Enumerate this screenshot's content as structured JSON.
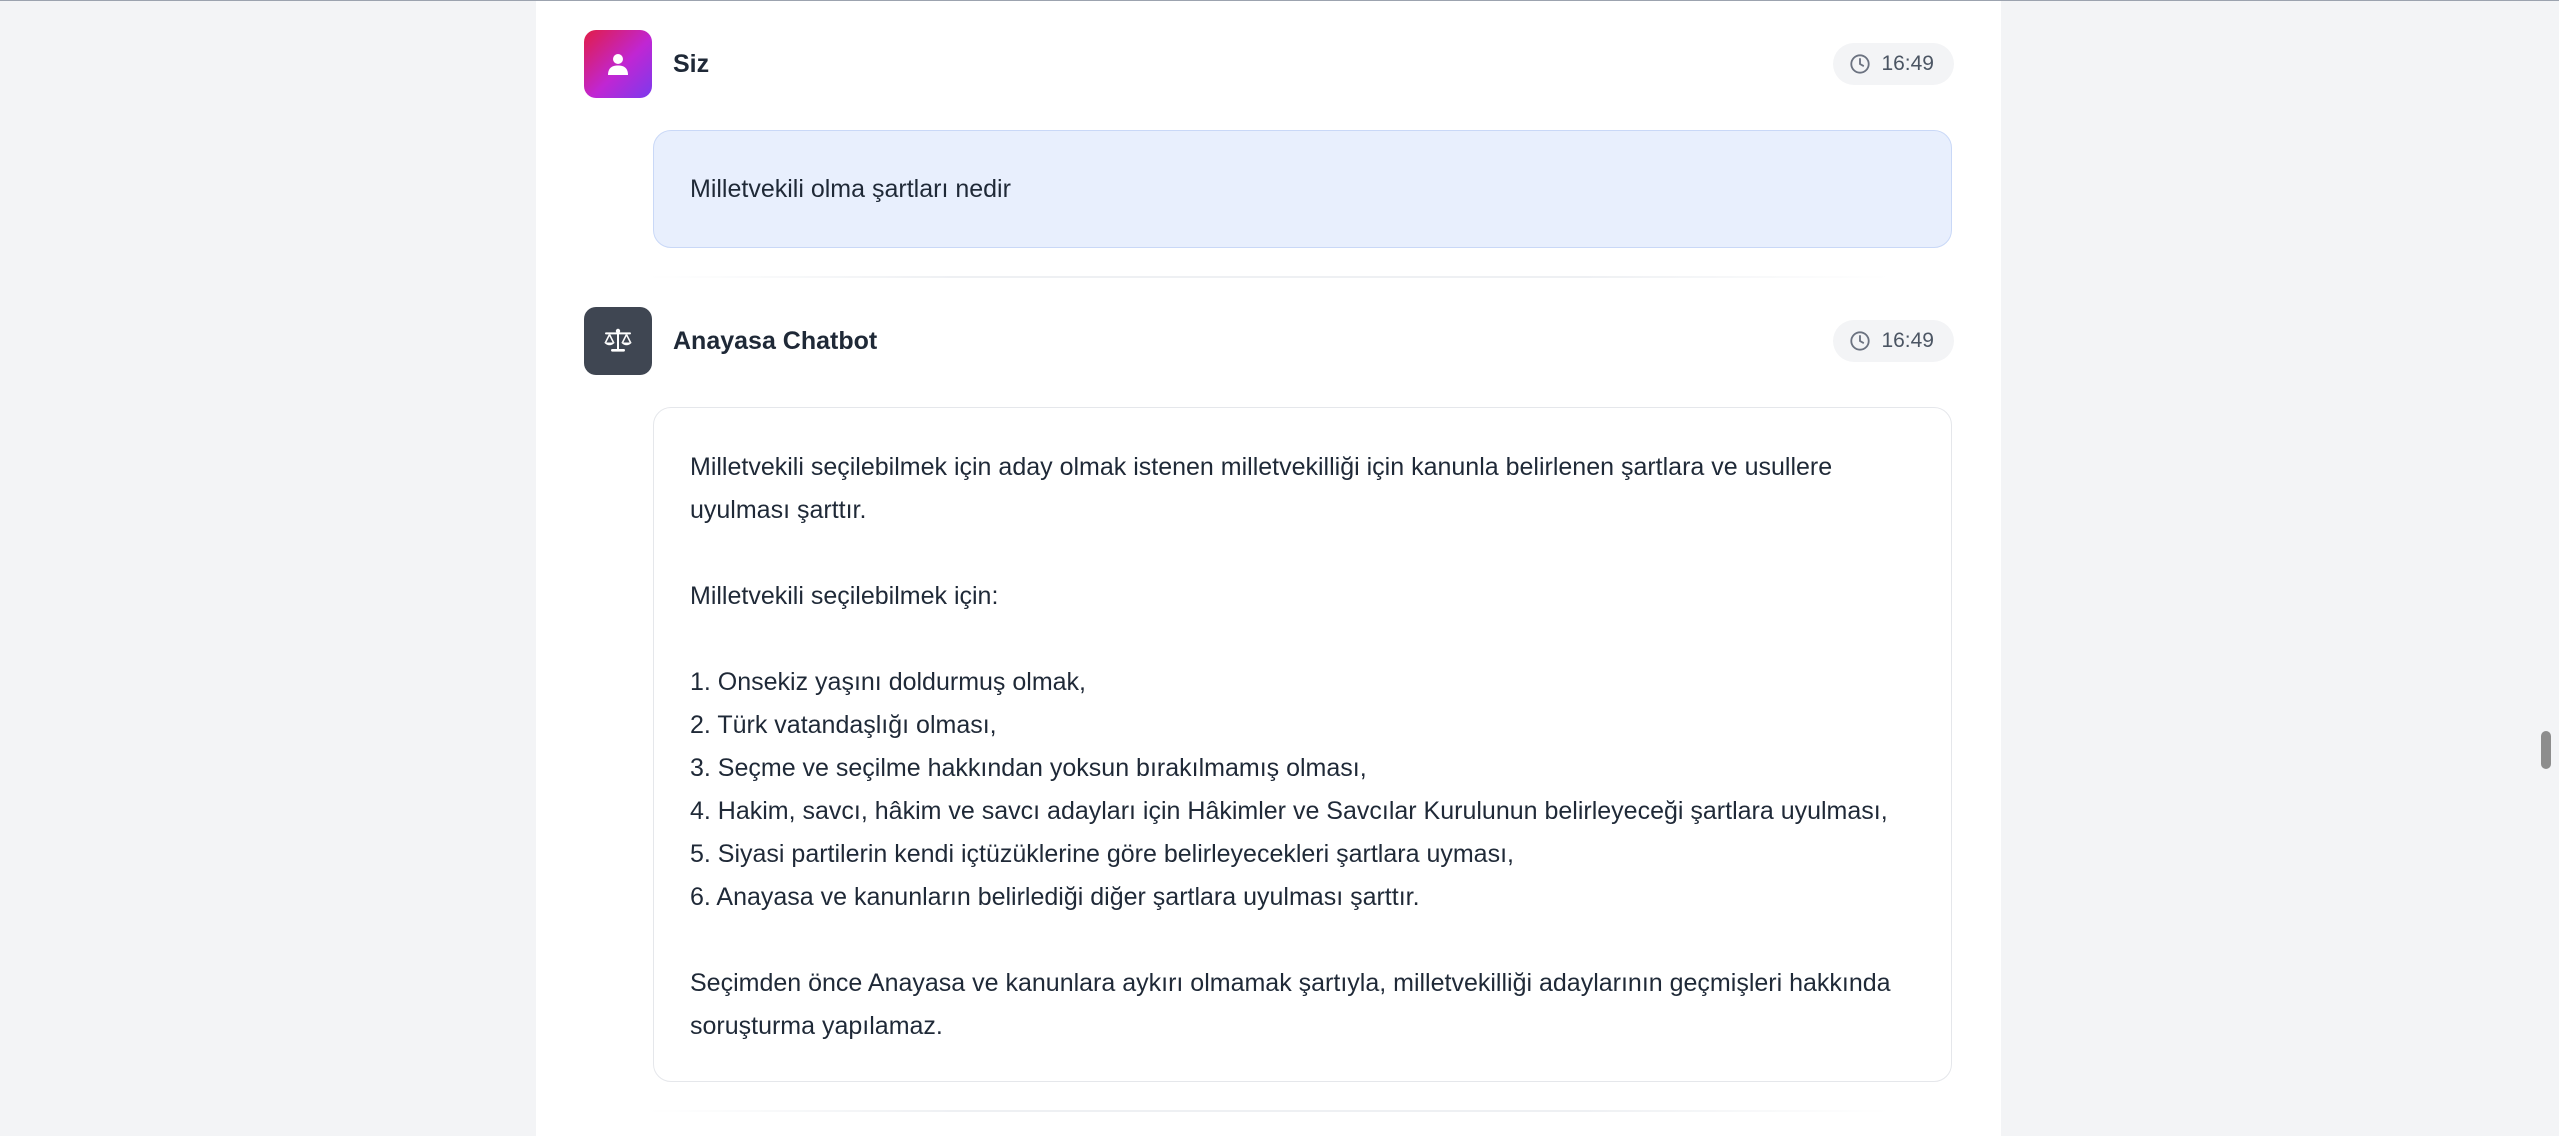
{
  "messages": [
    {
      "role": "user",
      "sender": "Siz",
      "avatar_icon": "user-icon",
      "time": "16:49",
      "text": "Milletvekili olma şartları nedir"
    },
    {
      "role": "bot",
      "sender": "Anayasa Chatbot",
      "avatar_icon": "scale-icon",
      "time": "16:49",
      "intro": "Milletvekili seçilebilmek için aday olmak istenen milletvekilliği için kanunla belirlenen şartlara ve usullere uyulması şarttır.",
      "list_title": "Milletvekili seçilebilmek için:",
      "items": [
        "1. Onsekiz yaşını doldurmuş olmak,",
        "2. Türk vatandaşlığı olması,",
        "3. Seçme ve seçilme hakkından yoksun bırakılmamış olması,",
        "4. Hakim, savcı, hâkim ve savcı adayları için Hâkimler ve Savcılar Kurulunun belirleyeceği şartlara uyulması,",
        "5. Siyasi partilerin kendi içtüzüklerine göre belirleyecekleri şartlara uyması,",
        "6. Anayasa ve kanunların belirlediği diğer şartlara uyulması şarttır."
      ],
      "closing": "Seçimden önce Anayasa ve kanunlara aykırı olmamak şartıyla, milletvekilliği adaylarının geçmişleri hakkında soruşturma yapılamaz."
    }
  ],
  "colors": {
    "user_avatar_gradient": [
      "#e11d48",
      "#c026d3",
      "#7c3aed"
    ],
    "bot_avatar": "#3f4652",
    "user_bubble": "#e8effd"
  }
}
